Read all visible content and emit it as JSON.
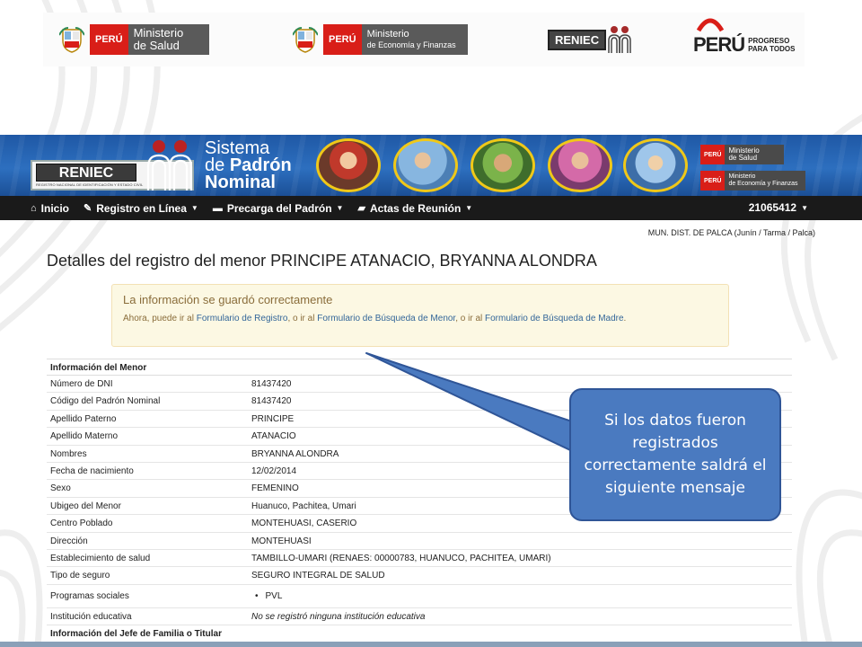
{
  "logos": {
    "minsa": {
      "peru": "PERÚ",
      "line1": "Ministerio",
      "line2": "de Salud"
    },
    "mef": {
      "peru": "PERÚ",
      "line1": "Ministerio",
      "line2": "de Economía y Finanzas"
    },
    "reniec": "RENIEC",
    "peru_brand": {
      "word": "PERÚ",
      "line1": "PROGRESO",
      "line2": "PARA TODOS"
    }
  },
  "banner": {
    "reniec": "RENIEC",
    "reniec_sub": "REGISTRO NACIONAL DE IDENTIFICACIÓN Y ESTADO CIVIL",
    "title_line1": "Sistema",
    "title_de": "de ",
    "title_padron": "Padrón",
    "title_line3": "Nominal",
    "mini1": {
      "p": "PERÚ",
      "m1": "Ministerio",
      "m2": "de Salud"
    },
    "mini2": {
      "p": "PERÚ",
      "m1": "Ministerio",
      "m2": "de Economía y Finanzas"
    }
  },
  "nav": {
    "inicio": "Inicio",
    "registro": "Registro en Línea",
    "precarga": "Precarga del Padrón",
    "actas": "Actas de Reunión",
    "user": "21065412"
  },
  "location": "MUN. DIST. DE PALCA (Junín / Tarma / Palca)",
  "page_title": "Detalles del registro del menor PRINCIPE ATANACIO, BRYANNA ALONDRA",
  "alert": {
    "title": "La información se guardó correctamente",
    "text1": "Ahora, puede ir al ",
    "link1": "Formulario de Registro",
    "text2": ", o ir al ",
    "link2": "Formulario de Búsqueda de Menor",
    "text3": ", o ir al ",
    "link3": "Formulario de Búsqueda de Madre",
    "text4": "."
  },
  "section_menor": "Información del Menor",
  "rows": [
    {
      "label": "Número de DNI",
      "value": "81437420"
    },
    {
      "label": "Código del Padrón Nominal",
      "value": "81437420"
    },
    {
      "label": "Apellido Paterno",
      "value": "PRINCIPE"
    },
    {
      "label": "Apellido Materno",
      "value": "ATANACIO"
    },
    {
      "label": "Nombres",
      "value": "BRYANNA ALONDRA"
    },
    {
      "label": "Fecha de nacimiento",
      "value": "12/02/2014"
    },
    {
      "label": "Sexo",
      "value": "FEMENINO"
    },
    {
      "label": "Ubigeo del Menor",
      "value": "Huanuco, Pachitea, Umari"
    },
    {
      "label": "Centro Poblado",
      "value": "MONTEHUASI, CASERIO"
    },
    {
      "label": "Dirección",
      "value": "MONTEHUASI"
    },
    {
      "label": "Establecimiento de salud",
      "value": "TAMBILLO-UMARI (RENAES: 00000783, HUANUCO, PACHITEA, UMARI)"
    },
    {
      "label": "Tipo de seguro",
      "value": "SEGURO INTEGRAL DE SALUD"
    }
  ],
  "programas": {
    "label": "Programas sociales",
    "value": "PVL"
  },
  "institucion": {
    "label": "Institución educativa",
    "value": "No se registró ninguna institución educativa"
  },
  "section_jefe": "Información del Jefe de Familia o Titular",
  "callout": "Si los datos fueron registrados correctamente saldrá el siguiente mensaje"
}
